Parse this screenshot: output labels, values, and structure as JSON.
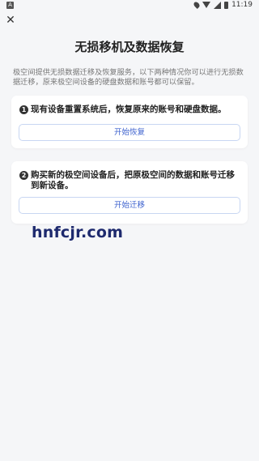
{
  "status_bar": {
    "left_badge": "A",
    "time": "11:19"
  },
  "page": {
    "title": "无损移机及数据恢复",
    "intro": "极空间提供无损数据迁移及恢复服务，以下两种情况你可以进行无损数据迁移，原来极空间设备的硬盘数据和账号都可以保留。"
  },
  "options": [
    {
      "number": "1",
      "text": "现有设备重置系统后，恢复原来的账号和硬盘数据。",
      "button": "开始恢复"
    },
    {
      "number": "2",
      "text": "购买新的极空间设备后，把原极空间的数据和账号迁移到新设备。",
      "button": "开始迁移"
    }
  ],
  "watermark": "hnfcjr.com"
}
